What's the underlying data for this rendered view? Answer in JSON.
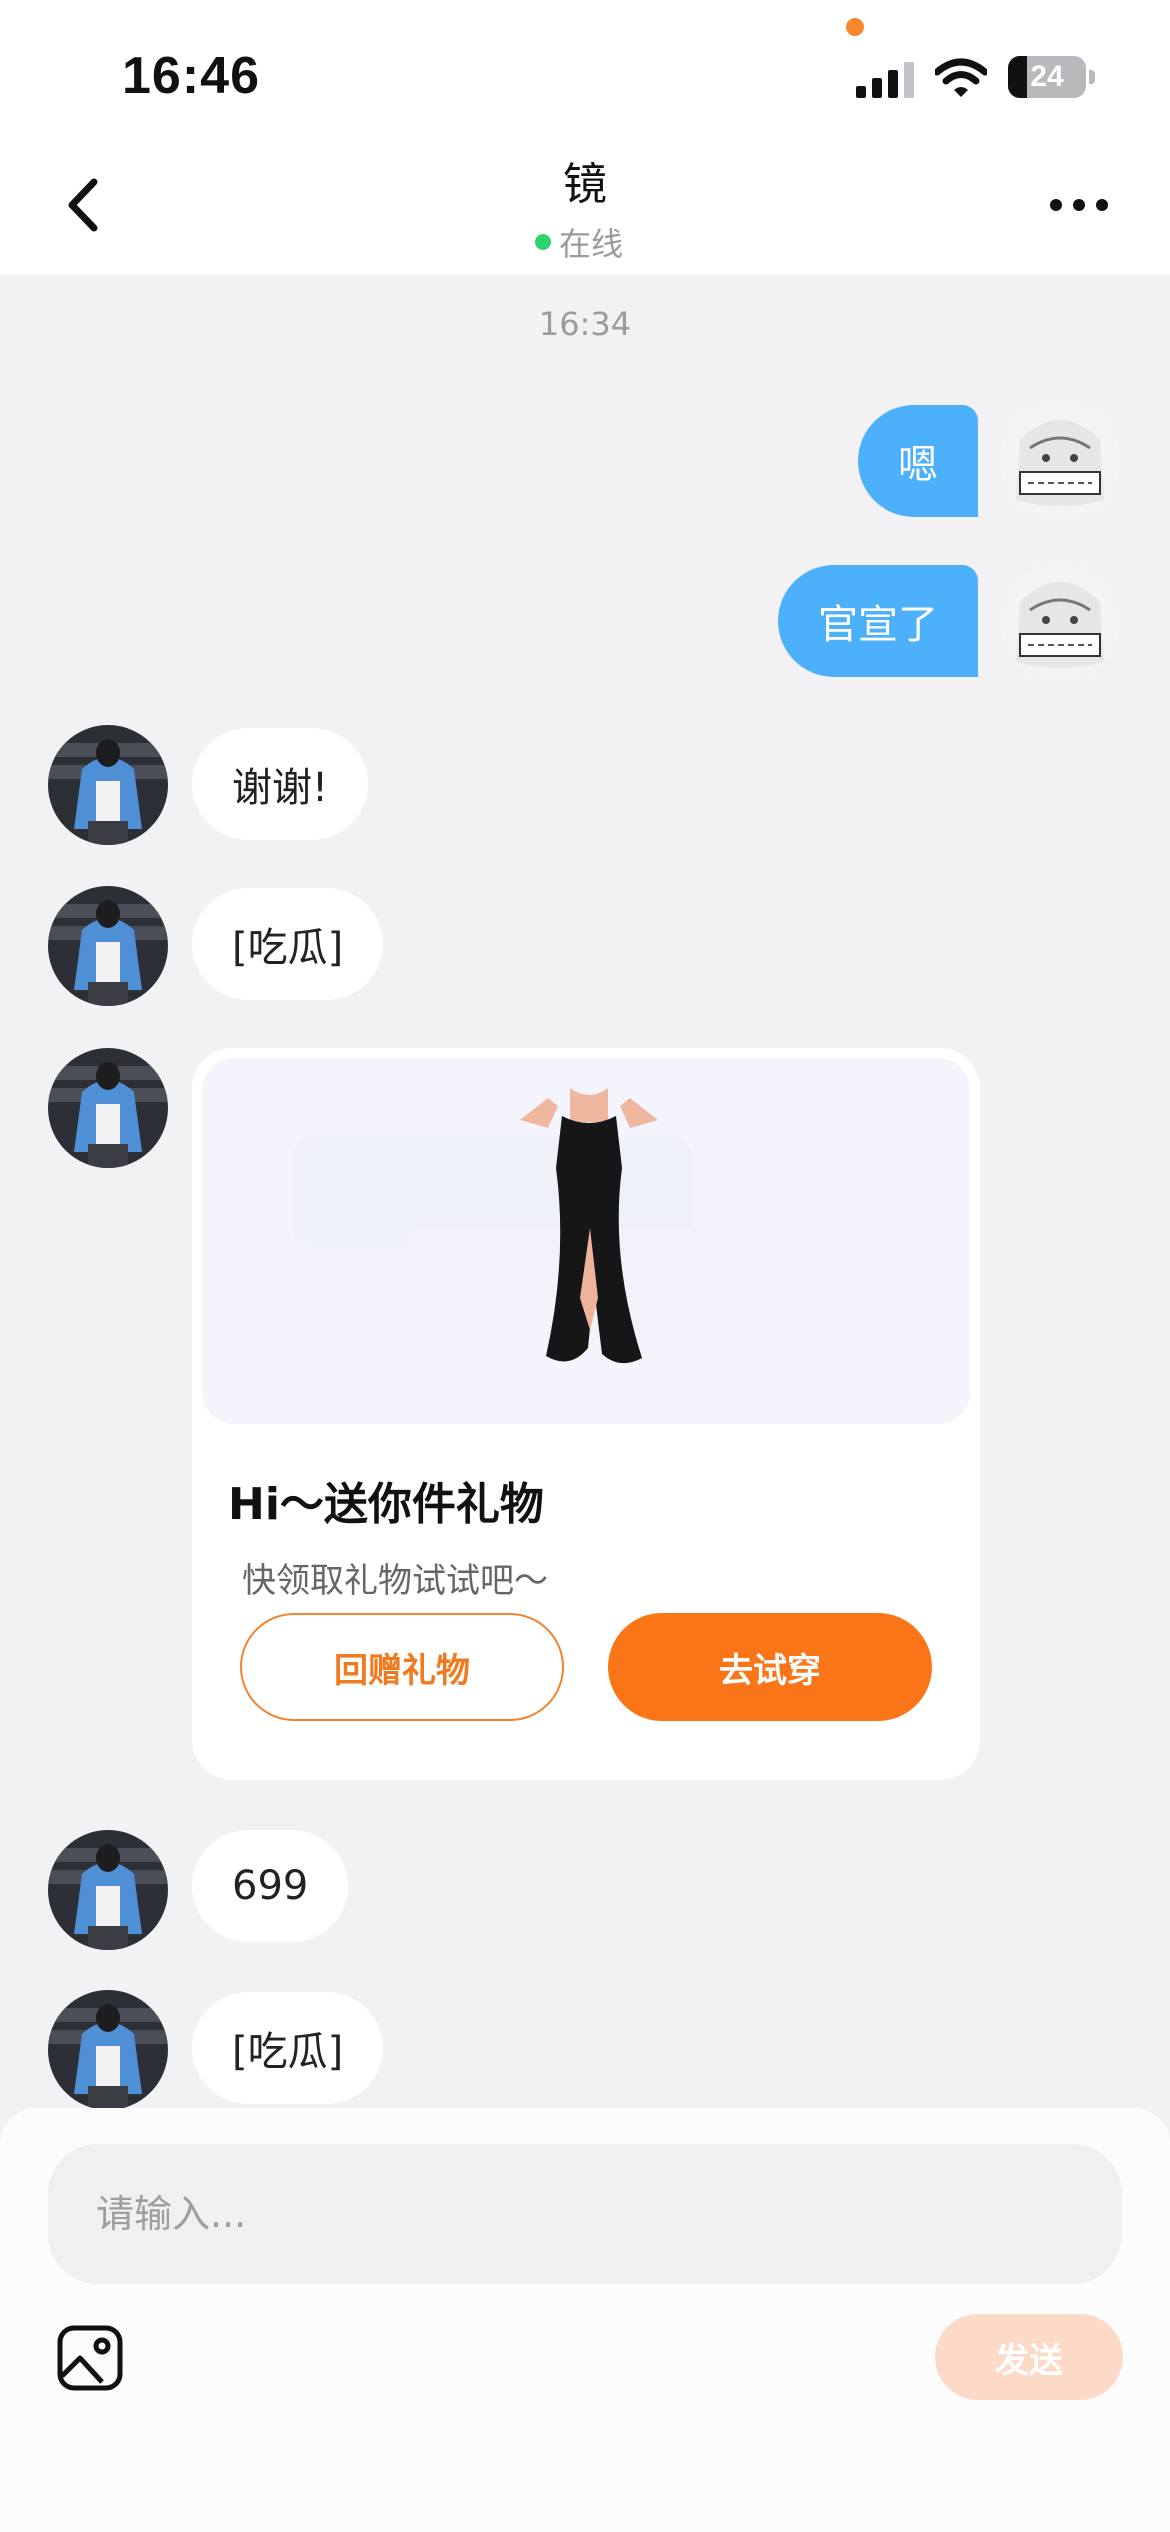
{
  "status_bar": {
    "time": "16:46",
    "battery": "24",
    "battery_level": 0.24
  },
  "header": {
    "title": "镜",
    "status": "在线"
  },
  "chat": {
    "timestamp": "16:34",
    "messages": [
      {
        "from": "me",
        "text": "嗯"
      },
      {
        "from": "me",
        "text": "官宣了"
      },
      {
        "from": "them",
        "text": "谢谢!"
      },
      {
        "from": "them",
        "text": "[吃瓜]"
      },
      {
        "from": "them",
        "text": "699"
      },
      {
        "from": "them",
        "text": "[吃瓜]"
      }
    ],
    "gift_card": {
      "title": "Hi～送你件礼物",
      "subtitle": "快领取礼物试试吧～",
      "return_button": "回赠礼物",
      "try_button": "去试穿"
    }
  },
  "composer": {
    "placeholder": "请输入...",
    "send_label": "发送"
  },
  "colors": {
    "my_bubble": "#4db0fa",
    "accent_orange": "#fa7517",
    "online_green": "#2ed36f",
    "send_disabled": "#fcdac7"
  },
  "icons": [
    "back-arrow-icon",
    "more-icon",
    "image-icon",
    "signal-icon",
    "wifi-icon",
    "battery-icon"
  ]
}
